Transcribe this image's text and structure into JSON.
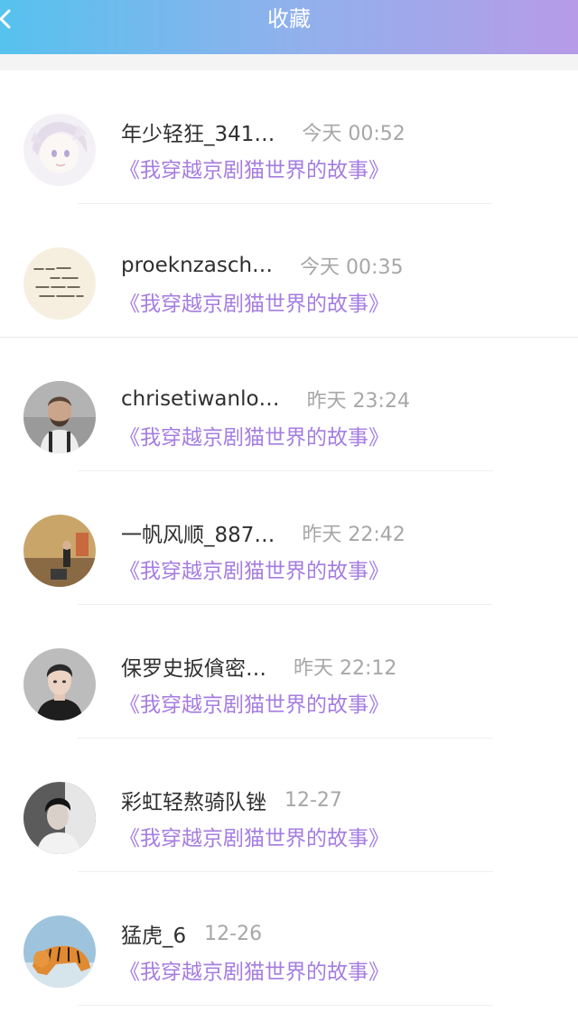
{
  "nav": {
    "title": "收藏",
    "back_icon": "chevron-left-icon"
  },
  "colors": {
    "gradient_start": "#56c2ee",
    "gradient_end": "#b79be8",
    "book_title": "#a57de0",
    "time": "#a7a7a7"
  },
  "favorites": [
    {
      "username": "年少轻狂_341…",
      "time": "今天 00:52",
      "book": "《我穿越京剧猫世界的故事》"
    },
    {
      "username": "proeknzasch…",
      "time": "今天 00:35",
      "book": "《我穿越京剧猫世界的故事》"
    },
    {
      "username": "chrisetiwanlo…",
      "time": "昨天 23:24",
      "book": "《我穿越京剧猫世界的故事》"
    },
    {
      "username": "一帆风顺_887…",
      "time": "昨天 22:42",
      "book": "《我穿越京剧猫世界的故事》"
    },
    {
      "username": "保罗史扳僋密…",
      "time": "昨天 22:12",
      "book": "《我穿越京剧猫世界的故事》"
    },
    {
      "username": "彩虹轻熬骑队锉",
      "time": "12-27",
      "book": "《我穿越京剧猫世界的故事》"
    },
    {
      "username": "猛虎_6",
      "time": "12-26",
      "book": "《我穿越京剧猫世界的故事》"
    }
  ]
}
